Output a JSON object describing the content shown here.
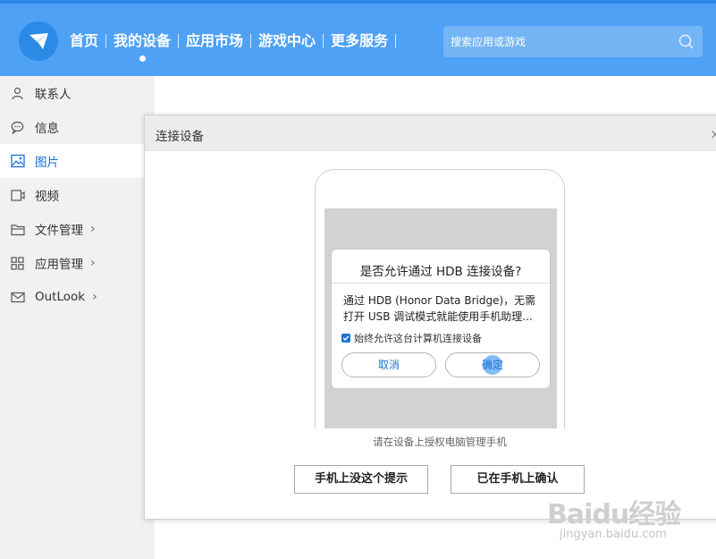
{
  "header": {
    "nav": [
      {
        "label": "首页",
        "active": false
      },
      {
        "label": "我的设备",
        "active": true
      },
      {
        "label": "应用市场",
        "active": false
      },
      {
        "label": "游戏中心",
        "active": false
      },
      {
        "label": "更多服务",
        "active": false
      }
    ],
    "search_placeholder": "搜索应用或游戏",
    "brand_color": "#4ea1f4"
  },
  "sidebar": {
    "items": [
      {
        "label": "联系人",
        "icon": "person-icon",
        "active": false,
        "expandable": false
      },
      {
        "label": "信息",
        "icon": "chat-bubble-icon",
        "active": false,
        "expandable": false
      },
      {
        "label": "图片",
        "icon": "picture-icon",
        "active": true,
        "expandable": false
      },
      {
        "label": "视频",
        "icon": "video-icon",
        "active": false,
        "expandable": false
      },
      {
        "label": "文件管理",
        "icon": "folder-icon",
        "active": false,
        "expandable": true
      },
      {
        "label": "应用管理",
        "icon": "app-grid-icon",
        "active": false,
        "expandable": true
      },
      {
        "label": "OutLook",
        "icon": "mail-icon",
        "active": false,
        "expandable": true
      }
    ],
    "chevron": "›"
  },
  "dialog": {
    "title": "连接设备",
    "close": "×",
    "phone_prompt": {
      "title": "是否允许通过 HDB 连接设备?",
      "body_line1": "通过 HDB (Honor Data Bridge)，无需",
      "body_line2": "打开 USB 调试模式就能使用手机助理...",
      "checkbox_label": "始终允许这台计算机连接设备",
      "checkbox_checked": true,
      "cancel_label": "取消",
      "ok_label": "确定"
    },
    "instruction": "请在设备上授权电脑管理手机",
    "btn_no_prompt": "手机上没这个提示",
    "btn_confirmed": "已在手机上确认"
  },
  "watermark": {
    "text": "Baidu经验",
    "sub": "jingyan.baidu.com"
  }
}
